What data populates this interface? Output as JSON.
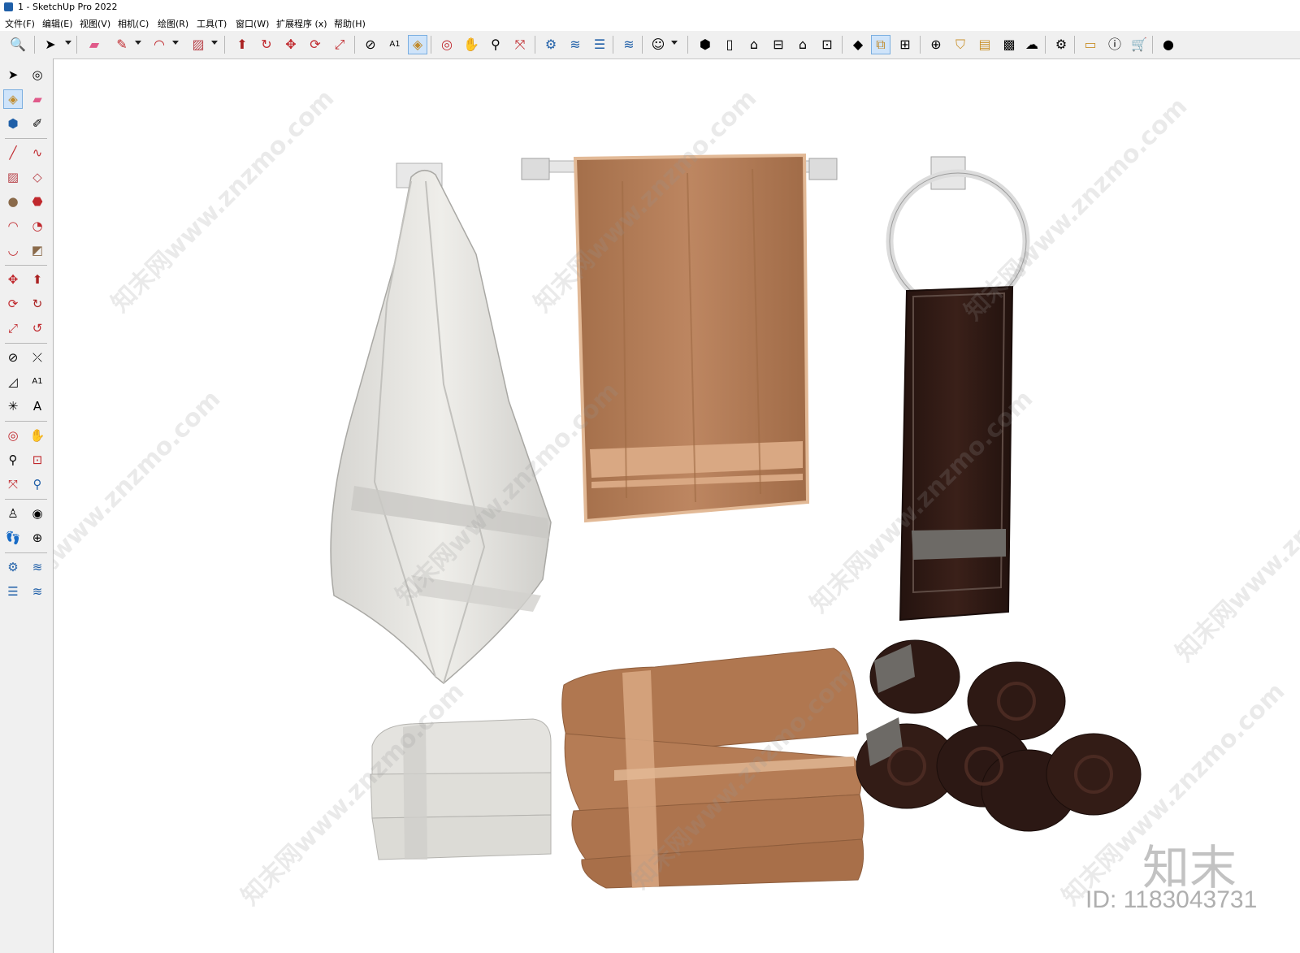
{
  "window": {
    "title": "1 - SketchUp Pro 2022"
  },
  "menu": [
    "文件(F)",
    "编辑(E)",
    "视图(V)",
    "相机(C)",
    "绘图(R)",
    "工具(T)",
    "窗口(W)",
    "扩展程序 (x)",
    "帮助(H)"
  ],
  "toolbar_icons": [
    "search-icon",
    "select-icon",
    "dropdown",
    "eraser-icon",
    "pencil-icon",
    "dropdown",
    "arc-icon",
    "dropdown",
    "rectangle-icon",
    "dropdown",
    "push-pull-icon",
    "follow-me-icon",
    "move-icon",
    "rotate-icon",
    "scale-icon",
    "tape-measure-icon",
    "text-icon",
    "paint-bucket-icon",
    "orbit-icon",
    "pan-icon",
    "zoom-icon",
    "zoom-extents-icon",
    "warehouse-icon",
    "extension-manager-icon",
    "layers-icon",
    "sandbox-icon",
    "user-icon",
    "dropdown",
    "iso-view-icon",
    "front-view-icon",
    "home-view-icon",
    "top-view-icon",
    "right-view-icon",
    "back-view-icon",
    "style-icon",
    "section-icon",
    "component-icon",
    "add-icon",
    "shield-icon",
    "texture-icon",
    "checker-icon",
    "cloud-upload-icon",
    "settings-icon",
    "message-icon",
    "info-icon",
    "cart-icon",
    "account-icon"
  ],
  "left_toolbar_icons": [
    "select-icon",
    "orbit-icon",
    "paint-bucket-icon",
    "eraser-icon",
    "component-icon",
    "eyedropper-icon",
    "line-icon",
    "freehand-icon",
    "rectangle-icon",
    "rotated-rectangle-icon",
    "circle-icon",
    "polygon-icon",
    "arc-icon",
    "pie-icon",
    "two-point-arc-icon",
    "three-point-arc-icon",
    "move-icon",
    "push-pull-icon",
    "rotate-icon",
    "follow-me-icon",
    "scale-icon",
    "offset-icon",
    "tape-measure-icon",
    "dimension-icon",
    "protractor-icon",
    "text-icon",
    "axes-icon",
    "3d-text-icon",
    "orbit-tool-icon",
    "pan-tool-icon",
    "zoom-tool-icon",
    "zoom-window-icon",
    "zoom-extents-icon",
    "previous-view-icon",
    "position-camera-icon",
    "look-around-icon",
    "walk-icon",
    "section-plane-icon",
    "warehouse-icon",
    "extension-icon",
    "layers-icon",
    "sandbox-icon"
  ],
  "watermarks": [
    "知末网www.znzmo.com",
    "知末网www.znzmo.com",
    "知末网www.znzmo.com",
    "知末网www.znzmo.com",
    "知末网www.znzmo.com",
    "知末网www.znzmo.com",
    "知末网www.znzmo.com",
    "知末网www.znzmo.com",
    "知末网www.znzmo.com",
    "知末网www.znzmo.com"
  ],
  "brand": {
    "logo_text": "知末",
    "id_text": "ID: 1183043731"
  },
  "scene_objects": [
    "hanging-white-towel",
    "brown-towel-on-bar",
    "dark-towel-on-ring",
    "folded-white-towels",
    "folded-brown-towels",
    "rolled-dark-towels"
  ],
  "colors": {
    "white_towel": "#e2e1dd",
    "brown_towel": "#b57c55",
    "brown_trim": "#d9a883",
    "dark_towel": "#2c1814",
    "dark_stripe": "#6d6a66",
    "chrome": "#e6e6e6",
    "toolbar_bg": "#f0f0f0"
  }
}
